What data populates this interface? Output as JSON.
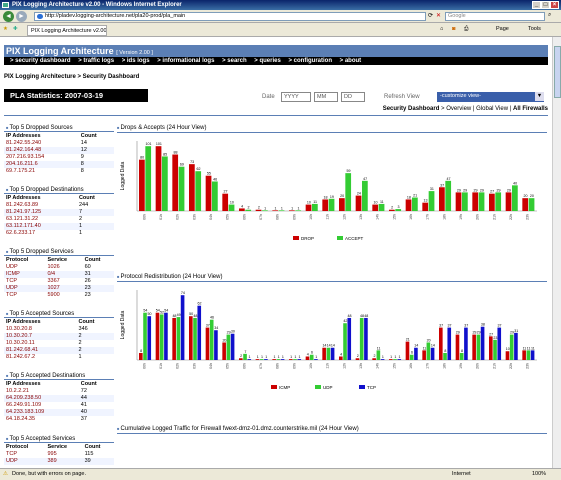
{
  "window": {
    "title": "PIX Logging Architecture v2.00 - Windows Internet Explorer",
    "url": "http://pladev.logging-architecture.net/pla20-prod/pla_main",
    "search_placeholder": "Google",
    "tab_label": "PIX Logging Architecture v2.00",
    "toolbar": {
      "page": "Page",
      "tools": "Tools"
    },
    "status_text": "Done, but with errors on page.",
    "zone": "Internet",
    "zoom": "100%"
  },
  "app": {
    "title": "PIX Logging Architecture",
    "version": "[ Version 2.00 ]",
    "menu": [
      " > security dashboard",
      " > traffic logs",
      " > ids logs",
      " > informational logs",
      " > search",
      " > queries",
      " > configuration",
      " > about"
    ],
    "breadcrumb": "PIX Logging Architecture > Security Dashboard",
    "stats_label": "PLA Statistics: 2007-03-19",
    "date_label": "Date",
    "date_fields": [
      "YYYY",
      "MM",
      "DD"
    ],
    "refresh_label": "Refresh View",
    "customize_label": "-customize view-",
    "views": {
      "current": "Security Dashboard",
      "sep1": " > ",
      "overview": "Overview",
      "sep2": " | ",
      "global": "Global View",
      "sep3": " | ",
      "firewalls": "All Firewalls"
    }
  },
  "sidebar": [
    {
      "title": "Top 5 Dropped Sources",
      "headers": [
        "IP Addresses",
        "Count"
      ],
      "rows": [
        [
          "81.242.55.240",
          "14"
        ],
        [
          "81.242.164.48",
          "12"
        ],
        [
          "207.216.93.154",
          "9"
        ],
        [
          "204.16.211.6",
          "8"
        ],
        [
          "69.7.175.21",
          "8"
        ]
      ]
    },
    {
      "title": "Top 5 Dropped Destinations",
      "headers": [
        "IP Addresses",
        "Count"
      ],
      "rows": [
        [
          "81.242.63.89",
          "244"
        ],
        [
          "81.241.97.125",
          "7"
        ],
        [
          "63.121.31.22",
          "2"
        ],
        [
          "63.112.171.40",
          "1"
        ],
        [
          "62.6.233.17",
          "1"
        ]
      ]
    },
    {
      "title": "Top 5 Dropped Services",
      "headers": [
        "Protocol",
        "Service",
        "Count"
      ],
      "rows": [
        [
          "UDP",
          "1026",
          "60"
        ],
        [
          "ICMP",
          "0/4",
          "31"
        ],
        [
          "TCP",
          "3367",
          "26"
        ],
        [
          "UDP",
          "1027",
          "23"
        ],
        [
          "TCP",
          "5900",
          "23"
        ]
      ]
    },
    {
      "title": "Top 5 Accepted Sources",
      "headers": [
        "IP Addresses",
        "Count"
      ],
      "rows": [
        [
          "10.30.20.8",
          "346"
        ],
        [
          "10.30.20.7",
          "2"
        ],
        [
          "10.30.20.11",
          "2"
        ],
        [
          "81.242.68.41",
          "2"
        ],
        [
          "81.242.67.2",
          "1"
        ]
      ]
    },
    {
      "title": "Top 5 Accepted Destinations",
      "headers": [
        "IP Addresses",
        "Count"
      ],
      "rows": [
        [
          "10.2.2.21",
          "72"
        ],
        [
          "64.209.238.50",
          "44"
        ],
        [
          "66.249.91.109",
          "41"
        ],
        [
          "64.233.183.109",
          "40"
        ],
        [
          "64.18.24.35",
          "37"
        ]
      ]
    },
    {
      "title": "Top 5 Accepted Services",
      "headers": [
        "Protocol",
        "Service",
        "Count"
      ],
      "rows": [
        [
          "TCP",
          "995",
          "115"
        ],
        [
          "UDP",
          "389",
          "39"
        ]
      ]
    }
  ],
  "panels": {
    "drops_title": "Drops & Accepts (24 Hour View)",
    "proto_title": "Protocol Redistribution (24 Hour View)",
    "cum_title": "Cumulative Logged Traffic for Firewall fwext-dmz-01.dmz.counterstrike.mil (24 Hour View)"
  },
  "chart_data": [
    {
      "type": "bar",
      "ylabel": "Logged Data",
      "categories": [
        "00h",
        "01h",
        "02h",
        "03h",
        "04h",
        "05h",
        "06h",
        "07h",
        "08h",
        "09h",
        "10h",
        "11h",
        "12h",
        "13h",
        "14h",
        "15h",
        "16h",
        "17h",
        "18h",
        "19h",
        "20h",
        "21h",
        "22h",
        "23h"
      ],
      "series": [
        {
          "name": "DROP",
          "color": "#cc0000",
          "values": [
            80,
            101,
            88,
            73,
            55,
            27,
            4,
            2,
            1,
            1,
            10,
            18,
            20,
            24,
            10,
            2,
            18,
            13,
            37,
            29,
            29,
            27,
            29,
            20
          ]
        },
        {
          "name": "ACCEPT",
          "color": "#33cc33",
          "values": [
            101,
            85,
            69,
            62,
            46,
            10,
            2,
            1,
            1,
            1,
            11,
            19,
            59,
            47,
            11,
            3,
            21,
            31,
            47,
            29,
            29,
            29,
            40,
            20
          ]
        }
      ]
    },
    {
      "type": "bar",
      "ylabel": "Logged Data",
      "categories": [
        "00h",
        "01h",
        "02h",
        "03h",
        "04h",
        "05h",
        "06h",
        "07h",
        "08h",
        "09h",
        "10h",
        "11h",
        "12h",
        "13h",
        "14h",
        "15h",
        "16h",
        "17h",
        "18h",
        "19h",
        "20h",
        "21h",
        "22h",
        "23h"
      ],
      "series": [
        {
          "name": "ICMP",
          "color": "#cc0000",
          "values": [
            8,
            54,
            48,
            50,
            37,
            20,
            2,
            1,
            1,
            1,
            4,
            14,
            4,
            2,
            2,
            1,
            21,
            11,
            37,
            29,
            29,
            27,
            10,
            11
          ]
        },
        {
          "name": "UDP",
          "color": "#33cc33",
          "values": [
            54,
            52,
            49,
            48,
            46,
            29,
            7,
            1,
            1,
            1,
            6,
            14,
            42,
            48,
            11,
            1,
            6,
            20,
            8,
            8,
            29,
            23,
            29,
            11
          ]
        },
        {
          "name": "TCP",
          "color": "#1010cc",
          "values": [
            50,
            54,
            74,
            62,
            34,
            30,
            1,
            1,
            1,
            1,
            1,
            14,
            48,
            48,
            1,
            1,
            14,
            14,
            37,
            37,
            38,
            37,
            31,
            11
          ]
        }
      ]
    }
  ]
}
